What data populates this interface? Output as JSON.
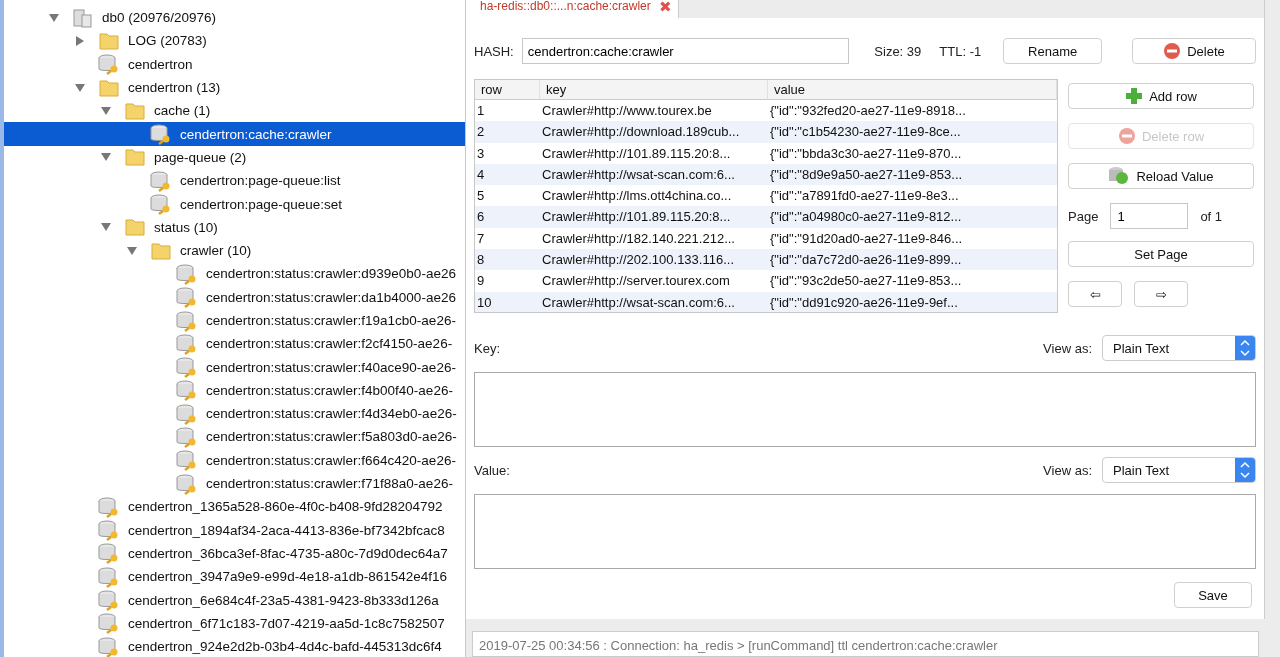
{
  "tree": [
    {
      "label": "db0 (20976/20976)",
      "kind": "database",
      "expanded": true,
      "selected": false,
      "children": [
        {
          "label": "LOG (20783)",
          "kind": "folder",
          "expanded": false,
          "selected": false
        },
        {
          "label": "cendertron",
          "kind": "key",
          "selected": false
        },
        {
          "label": "cendertron (13)",
          "kind": "folder",
          "expanded": true,
          "selected": false,
          "children": [
            {
              "label": "cache (1)",
              "kind": "folder",
              "expanded": true,
              "selected": false,
              "children": [
                {
                  "label": "cendertron:cache:crawler",
                  "kind": "key",
                  "selected": true
                }
              ]
            },
            {
              "label": "page-queue (2)",
              "kind": "folder",
              "expanded": true,
              "selected": false,
              "children": [
                {
                  "label": "cendertron:page-queue:list",
                  "kind": "key",
                  "selected": false
                },
                {
                  "label": "cendertron:page-queue:set",
                  "kind": "key",
                  "selected": false
                }
              ]
            },
            {
              "label": "status (10)",
              "kind": "folder",
              "expanded": true,
              "selected": false,
              "children": [
                {
                  "label": "crawler (10)",
                  "kind": "folder",
                  "expanded": true,
                  "selected": false,
                  "children": [
                    {
                      "label": "cendertron:status:crawler:d939e0b0-ae26",
                      "kind": "key",
                      "selected": false
                    },
                    {
                      "label": "cendertron:status:crawler:da1b4000-ae26",
                      "kind": "key",
                      "selected": false
                    },
                    {
                      "label": "cendertron:status:crawler:f19a1cb0-ae26-",
                      "kind": "key",
                      "selected": false
                    },
                    {
                      "label": "cendertron:status:crawler:f2cf4150-ae26-",
                      "kind": "key",
                      "selected": false
                    },
                    {
                      "label": "cendertron:status:crawler:f40ace90-ae26-",
                      "kind": "key",
                      "selected": false
                    },
                    {
                      "label": "cendertron:status:crawler:f4b00f40-ae26-",
                      "kind": "key",
                      "selected": false
                    },
                    {
                      "label": "cendertron:status:crawler:f4d34eb0-ae26-",
                      "kind": "key",
                      "selected": false
                    },
                    {
                      "label": "cendertron:status:crawler:f5a803d0-ae26-",
                      "kind": "key",
                      "selected": false
                    },
                    {
                      "label": "cendertron:status:crawler:f664c420-ae26-",
                      "kind": "key",
                      "selected": false
                    },
                    {
                      "label": "cendertron:status:crawler:f71f88a0-ae26-",
                      "kind": "key",
                      "selected": false
                    }
                  ]
                }
              ]
            }
          ]
        },
        {
          "label": "cendertron_1365a528-860e-4f0c-b408-9fd28204792",
          "kind": "key",
          "selected": false
        },
        {
          "label": "cendertron_1894af34-2aca-4413-836e-bf7342bfcac8",
          "kind": "key",
          "selected": false
        },
        {
          "label": "cendertron_36bca3ef-8fac-4735-a80c-7d9d0dec64a7",
          "kind": "key",
          "selected": false
        },
        {
          "label": "cendertron_3947a9e9-e99d-4e18-a1db-861542e4f16",
          "kind": "key",
          "selected": false
        },
        {
          "label": "cendertron_6e684c4f-23a5-4381-9423-8b333d126a",
          "kind": "key",
          "selected": false
        },
        {
          "label": "cendertron_6f71c183-7d07-4219-aa5d-1c8c7582507",
          "kind": "key",
          "selected": false
        },
        {
          "label": "cendertron_924e2d2b-03b4-4d4c-bafd-445313dc6f4",
          "kind": "key",
          "selected": false
        }
      ]
    }
  ],
  "tab": {
    "title": "ha-redis::db0::...n:cache:crawler",
    "close": "✖"
  },
  "header": {
    "type_label": "HASH:",
    "key_name": "cendertron:cache:crawler",
    "size": "Size: 39",
    "ttl": "TTL:  -1",
    "rename": "Rename",
    "delete": "Delete"
  },
  "table": {
    "columns": [
      "row",
      "key",
      "value"
    ],
    "rows": [
      [
        "1",
        "Crawler#http://www.tourex.be",
        "{\"id\":\"932fed20-ae27-11e9-8918..."
      ],
      [
        "2",
        "Crawler#http://download.189cub...",
        "{\"id\":\"c1b54230-ae27-11e9-8ce..."
      ],
      [
        "3",
        "Crawler#http://101.89.115.20:8...",
        "{\"id\":\"bbda3c30-ae27-11e9-870..."
      ],
      [
        "4",
        "Crawler#http://wsat-scan.com:6...",
        "{\"id\":\"8d9e9a50-ae27-11e9-853..."
      ],
      [
        "5",
        "Crawler#http://lms.ott4china.co...",
        "{\"id\":\"a7891fd0-ae27-11e9-8e3..."
      ],
      [
        "6",
        "Crawler#http://101.89.115.20:8...",
        "{\"id\":\"a04980c0-ae27-11e9-812..."
      ],
      [
        "7",
        "Crawler#http://182.140.221.212...",
        "{\"id\":\"91d20ad0-ae27-11e9-846..."
      ],
      [
        "8",
        "Crawler#http://202.100.133.116...",
        "{\"id\":\"da7c72d0-ae26-11e9-899..."
      ],
      [
        "9",
        "Crawler#http://server.tourex.com",
        "{\"id\":\"93c2de50-ae27-11e9-853..."
      ],
      [
        "10",
        "Crawler#http://wsat-scan.com:6...",
        "{\"id\":\"dd91c920-ae26-11e9-9ef..."
      ]
    ]
  },
  "side_buttons": [
    {
      "label": "Add row",
      "kind": "add",
      "disabled": false
    },
    {
      "label": "Delete row",
      "kind": "remove",
      "disabled": true
    },
    {
      "label": "Reload Value",
      "kind": "reload",
      "disabled": false
    }
  ],
  "paging": {
    "label": "Page",
    "value": "1",
    "of": "of 1",
    "set_page": "Set Page",
    "prev": "⇦",
    "next": "⇨"
  },
  "key_editor": {
    "label": "Key:",
    "view_as": "View as:",
    "format": "Plain Text"
  },
  "value_editor": {
    "label": "Value:",
    "view_as": "View as:",
    "format": "Plain Text"
  },
  "save": "Save",
  "log": "2019-07-25 00:34:56 : Connection: ha_redis > [runCommand] ttl cendertron:cache:crawler"
}
